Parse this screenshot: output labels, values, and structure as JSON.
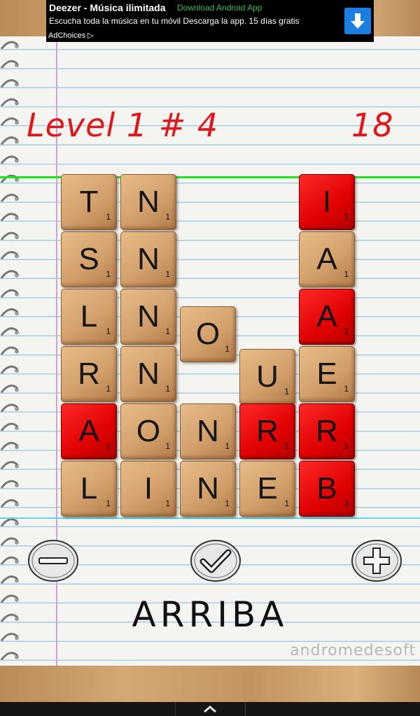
{
  "ad": {
    "title": "Deezer - Música ilimitada",
    "link": "Download Android App",
    "description": "Escucha toda la música en tu móvil Descarga la app. 15 días gratis",
    "choices": "AdChoices ▷"
  },
  "hud": {
    "level": "Level 1  # 4",
    "score": "18"
  },
  "tiles": [
    {
      "letter": "T",
      "points": "1",
      "color": "wood",
      "col": 0,
      "row": 0
    },
    {
      "letter": "S",
      "points": "1",
      "color": "wood",
      "col": 0,
      "row": 1
    },
    {
      "letter": "L",
      "points": "1",
      "color": "wood",
      "col": 0,
      "row": 2
    },
    {
      "letter": "R",
      "points": "1",
      "color": "wood",
      "col": 0,
      "row": 3
    },
    {
      "letter": "A",
      "points": "1",
      "color": "red",
      "col": 0,
      "row": 4
    },
    {
      "letter": "L",
      "points": "1",
      "color": "wood",
      "col": 0,
      "row": 5
    },
    {
      "letter": "N",
      "points": "1",
      "color": "wood",
      "col": 1,
      "row": 0
    },
    {
      "letter": "N",
      "points": "1",
      "color": "wood",
      "col": 1,
      "row": 1
    },
    {
      "letter": "N",
      "points": "1",
      "color": "wood",
      "col": 1,
      "row": 2
    },
    {
      "letter": "N",
      "points": "1",
      "color": "wood",
      "col": 1,
      "row": 3
    },
    {
      "letter": "O",
      "points": "1",
      "color": "wood",
      "col": 1,
      "row": 4
    },
    {
      "letter": "I",
      "points": "1",
      "color": "wood",
      "col": 1,
      "row": 5
    },
    {
      "letter": "O",
      "points": "1",
      "color": "wood",
      "col": 2,
      "row": "2.3"
    },
    {
      "letter": "N",
      "points": "1",
      "color": "wood",
      "col": 2,
      "row": 4
    },
    {
      "letter": "N",
      "points": "1",
      "color": "wood",
      "col": 2,
      "row": 5
    },
    {
      "letter": "U",
      "points": "1",
      "color": "wood",
      "col": 3,
      "row": "3.05"
    },
    {
      "letter": "R",
      "points": "1",
      "color": "red",
      "col": 3,
      "row": 4
    },
    {
      "letter": "E",
      "points": "1",
      "color": "wood",
      "col": 3,
      "row": 5
    },
    {
      "letter": "I",
      "points": "1",
      "color": "red",
      "col": 4,
      "row": 0
    },
    {
      "letter": "A",
      "points": "1",
      "color": "wood",
      "col": 4,
      "row": 1
    },
    {
      "letter": "A",
      "points": "1",
      "color": "red",
      "col": 4,
      "row": 2
    },
    {
      "letter": "E",
      "points": "1",
      "color": "wood",
      "col": 4,
      "row": 3
    },
    {
      "letter": "R",
      "points": "1",
      "color": "red",
      "col": 4,
      "row": 4
    },
    {
      "letter": "B",
      "points": "3",
      "color": "red",
      "col": 4,
      "row": 5
    }
  ],
  "controls": {
    "minus_icon": "minus-icon",
    "check_icon": "check-icon",
    "plus_icon": "plus-icon"
  },
  "current_word": "ARRIBA",
  "brand": "andromedesoft",
  "colors": {
    "hud_red": "#e0161b",
    "tile_red": "#e00000",
    "tile_wood": "#d3a06c",
    "green_line": "#22e022"
  }
}
